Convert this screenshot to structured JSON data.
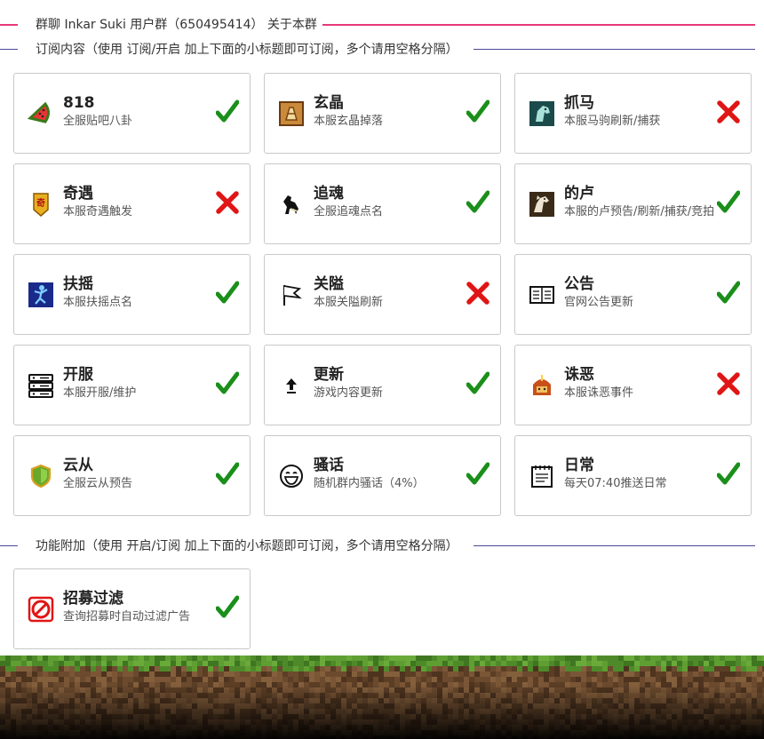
{
  "header": {
    "group_title": "群聊 Inkar Suki 用户群（650495414） 关于本群",
    "subscribe_section": "订阅内容（使用 订阅/开启 加上下面的小标题即可订阅，多个请用空格分隔）",
    "feature_section": "功能附加（使用 开启/订阅 加上下面的小标题即可订阅，多个请用空格分隔）"
  },
  "subscriptions": [
    {
      "title": "818",
      "desc": "全服贴吧八卦",
      "icon": "watermelon-icon",
      "enabled": true
    },
    {
      "title": "玄晶",
      "desc": "本服玄晶掉落",
      "icon": "xuanjing-crystal-icon",
      "enabled": true
    },
    {
      "title": "抓马",
      "desc": "本服马驹刷新/捕获",
      "icon": "horse-head-icon",
      "enabled": false
    },
    {
      "title": "奇遇",
      "desc": "本服奇遇触发",
      "icon": "qiyu-badge-icon",
      "enabled": false
    },
    {
      "title": "追魂",
      "desc": "全服追魂点名",
      "icon": "rearing-horse-icon",
      "enabled": true
    },
    {
      "title": "的卢",
      "desc": "本服的卢预告/刷新/捕获/竞拍",
      "icon": "dilu-horse-icon",
      "enabled": true
    },
    {
      "title": "扶摇",
      "desc": "本服扶摇点名",
      "icon": "fuyao-jump-icon",
      "enabled": true
    },
    {
      "title": "关隘",
      "desc": "本服关隘刷新",
      "icon": "flag-icon",
      "enabled": false
    },
    {
      "title": "公告",
      "desc": "官网公告更新",
      "icon": "newspaper-icon",
      "enabled": true
    },
    {
      "title": "开服",
      "desc": "本服开服/维护",
      "icon": "server-icon",
      "enabled": true
    },
    {
      "title": "更新",
      "desc": "游戏内容更新",
      "icon": "arrow-up-icon",
      "enabled": true
    },
    {
      "title": "诛恶",
      "desc": "本服诛恶事件",
      "icon": "warrior-helmet-icon",
      "enabled": false
    },
    {
      "title": "云从",
      "desc": "全服云从预告",
      "icon": "shield-icon",
      "enabled": true
    },
    {
      "title": "骚话",
      "desc": "随机群内骚话（4%）",
      "icon": "laughing-face-icon",
      "enabled": true
    },
    {
      "title": "日常",
      "desc": "每天07:40推送日常",
      "icon": "notepad-icon",
      "enabled": true
    }
  ],
  "features": [
    {
      "title": "招募过滤",
      "desc": "查询招募时自动过滤广告",
      "icon": "prohibited-icon",
      "enabled": true
    }
  ],
  "colors": {
    "accent_pink": "#e8387a",
    "divider_navy": "#4a4a9a",
    "check_green": "#1a8f1a",
    "cross_red": "#e01515",
    "card_border": "#c9c9c9"
  }
}
